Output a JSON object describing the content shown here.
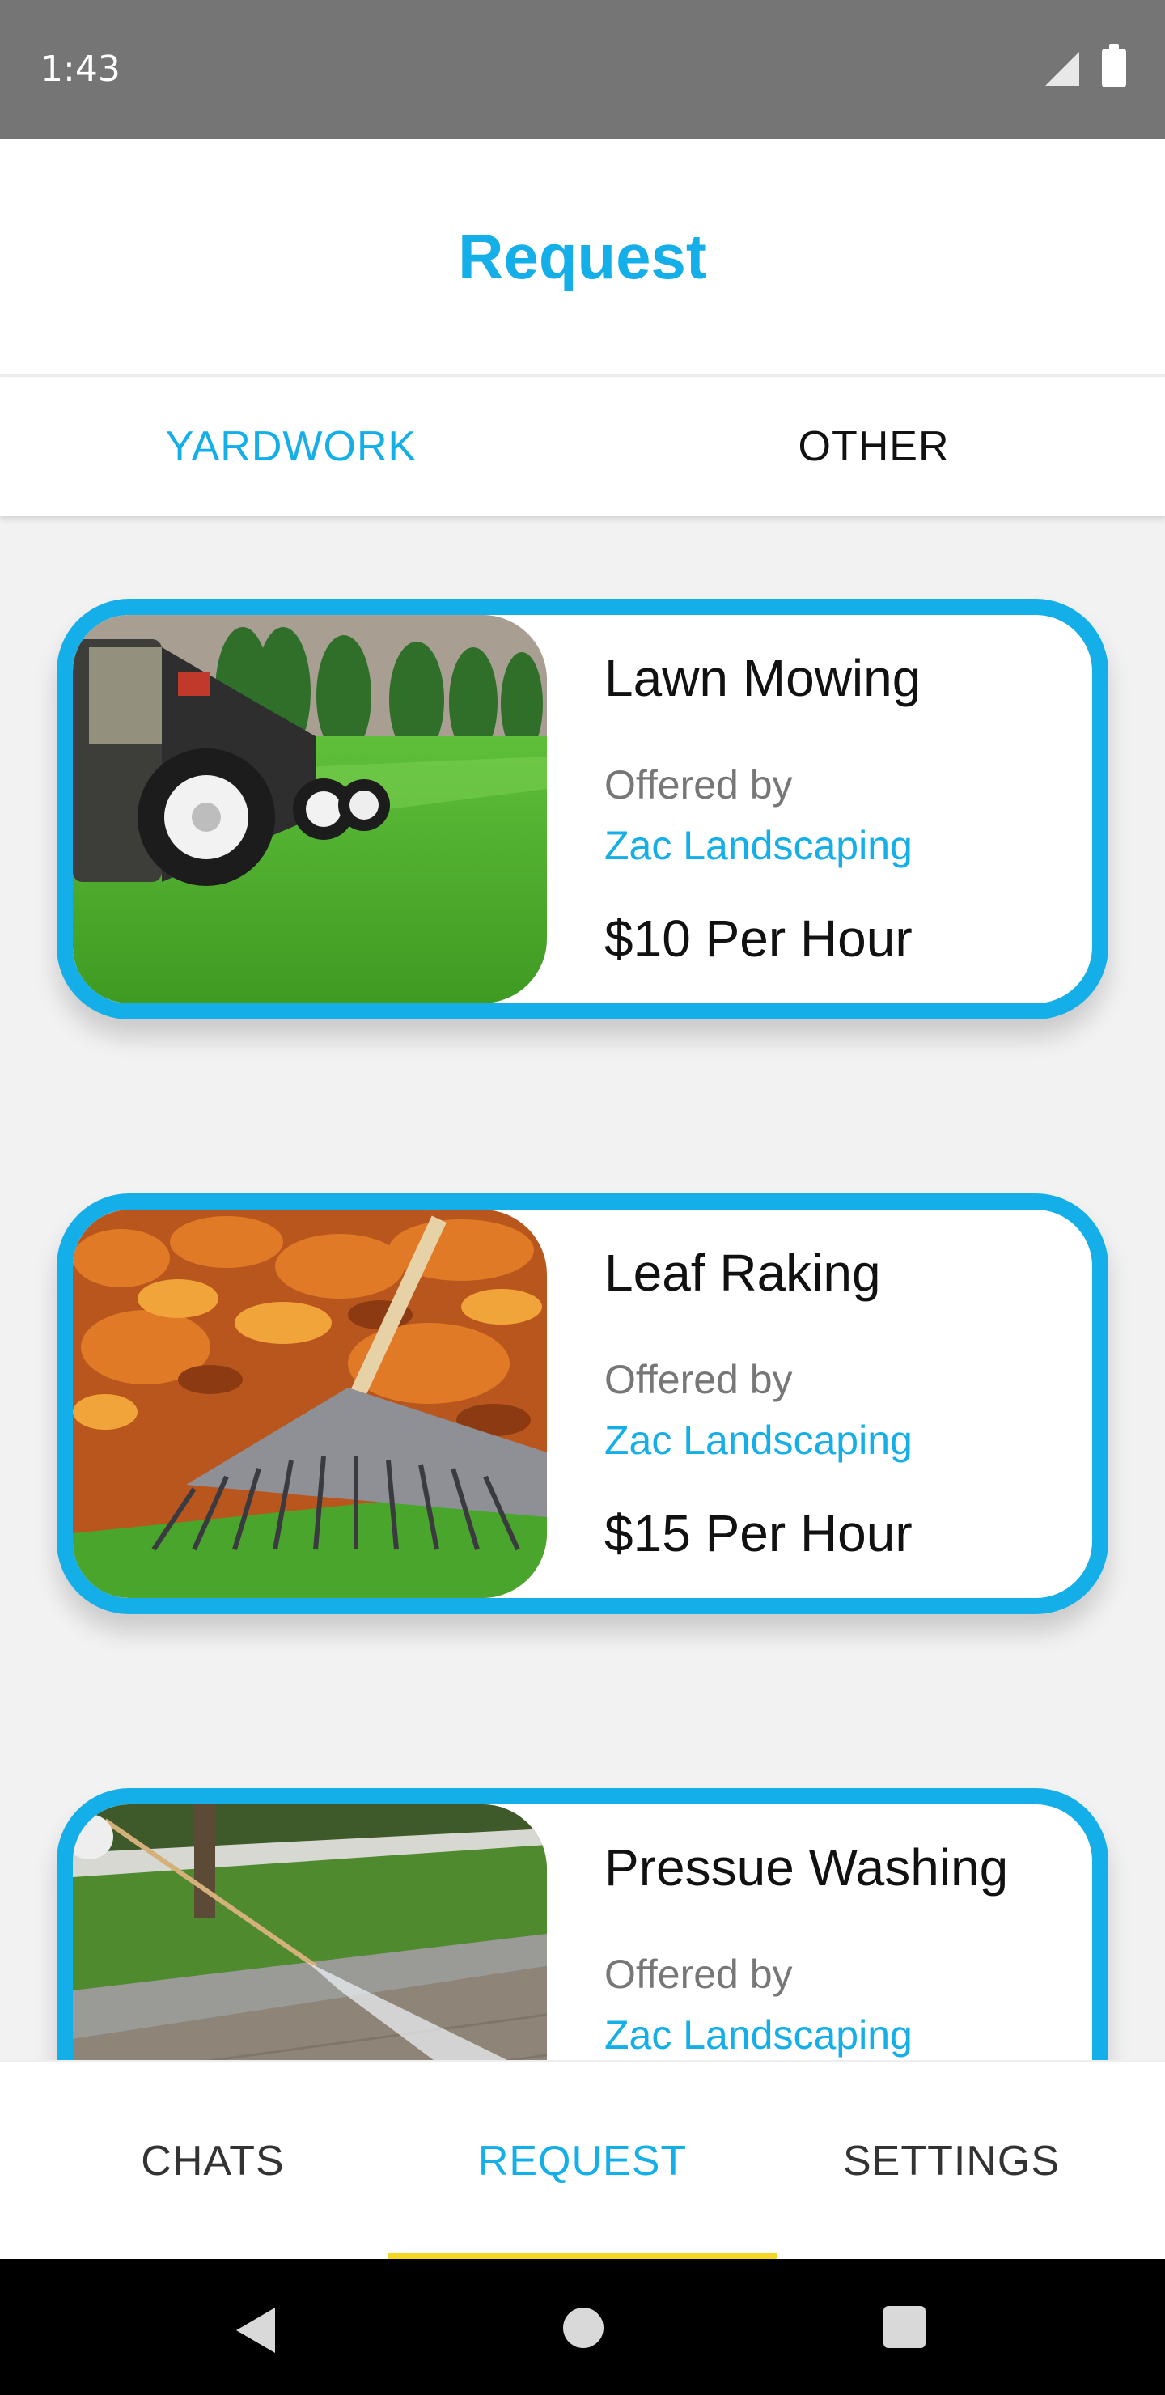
{
  "status_bar": {
    "time": "1:43"
  },
  "header": {
    "title": "Request"
  },
  "tabs": [
    {
      "label": "YARDWORK",
      "selected": true
    },
    {
      "label": "OTHER",
      "selected": false
    }
  ],
  "services": [
    {
      "title": "Lawn Mowing",
      "offered_by_label": "Offered by",
      "provider": "Zac Landscaping",
      "price": "$10 Per Hour",
      "image": "lawn-mower-photo"
    },
    {
      "title": "Leaf Raking",
      "offered_by_label": "Offered by",
      "provider": "Zac Landscaping",
      "price": "$15 Per Hour",
      "image": "leaf-rake-photo"
    },
    {
      "title": "Pressue Washing",
      "offered_by_label": "Offered by",
      "provider": "Zac Landscaping",
      "price": "",
      "image": "pressure-washer-photo"
    }
  ],
  "bottom_nav": {
    "items": [
      {
        "label": "CHATS"
      },
      {
        "label": "REQUEST"
      },
      {
        "label": "SETTINGS"
      }
    ],
    "active": "REQUEST"
  },
  "system_nav": {
    "back_icon": "back-triangle-icon",
    "home_icon": "home-circle-icon",
    "recents_icon": "recents-square-icon"
  },
  "colors": {
    "accent": "#14aee8",
    "active_indicator": "#f5d623",
    "status_bar": "#757575",
    "background": "#f2f2f2"
  }
}
